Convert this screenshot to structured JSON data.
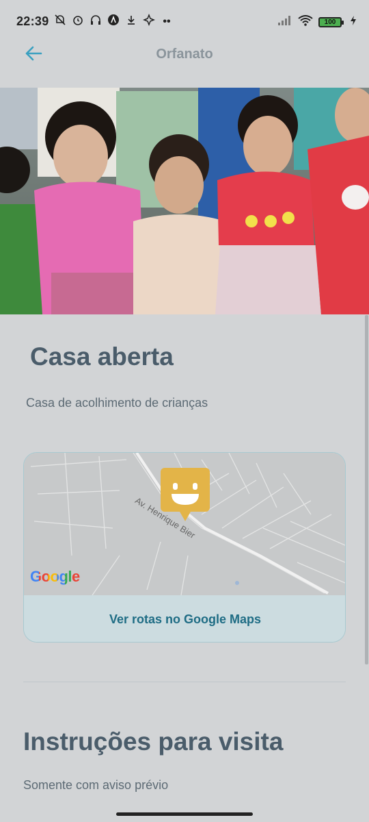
{
  "status_bar": {
    "time": "22:39",
    "left_icons": [
      "bell-off-icon",
      "alarm-icon",
      "headphones-icon",
      "app-icon",
      "download-icon",
      "gamepad-icon",
      "more-dots-icon"
    ],
    "battery": "100",
    "right_icons": [
      "signal-icon",
      "wifi-icon",
      "battery-icon",
      "charging-icon"
    ]
  },
  "header": {
    "title": "Orfanato",
    "back_icon": "arrow-left-icon",
    "accent_color": "#3aa0c0"
  },
  "hero_image": {
    "description_icon": "children-photo"
  },
  "orphanage": {
    "name": "Casa aberta",
    "about": "Casa de acolhimento de crianças"
  },
  "map": {
    "street_label": "Av. Henrique Bier",
    "provider_logo": "Google",
    "pin_color": "#e3b448",
    "route_button_label": "Ver rotas no Google Maps"
  },
  "instructions": {
    "title": "Instruções para visita",
    "text": "Somente com aviso prévio"
  }
}
